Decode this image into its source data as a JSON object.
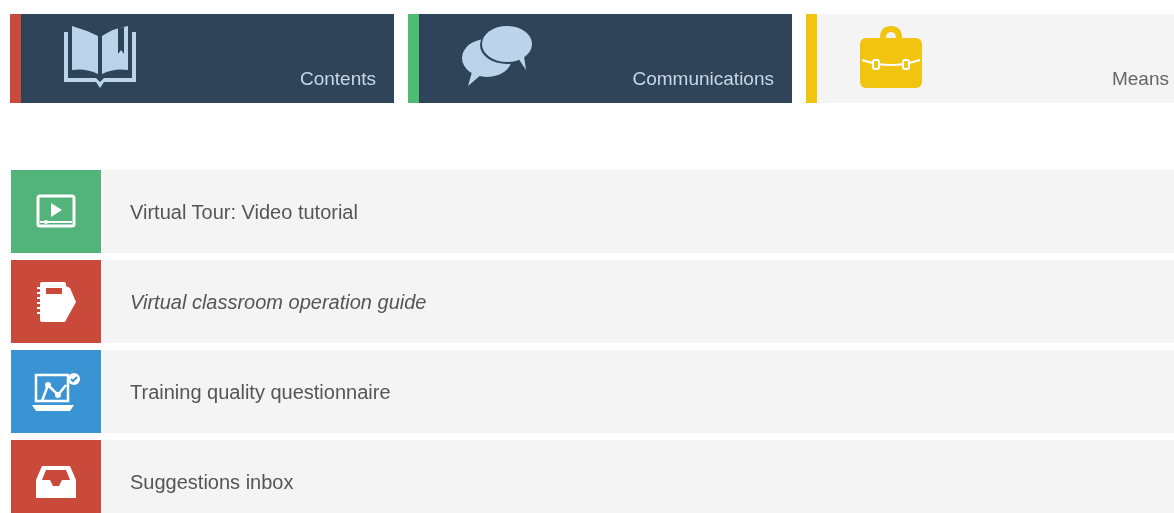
{
  "tiles": [
    {
      "label": "Contents",
      "kind": "book",
      "dark": true,
      "color": "#c9493a"
    },
    {
      "label": "Communications",
      "kind": "chat",
      "dark": true,
      "color": "#4dbd74"
    },
    {
      "label": "Means",
      "kind": "briefcase",
      "dark": false,
      "color": "#f1c40f"
    }
  ],
  "links": [
    {
      "label": "Virtual Tour: Video tutorial",
      "kind": "video",
      "color": "#52b47a",
      "italic": false
    },
    {
      "label": "Virtual classroom operation guide",
      "kind": "notebook",
      "color": "#c9493a",
      "italic": true
    },
    {
      "label": "Training quality questionnaire",
      "kind": "chart",
      "color": "#3a94d4",
      "italic": false
    },
    {
      "label": "Suggestions inbox",
      "kind": "inbox",
      "color": "#c9493a",
      "italic": false
    }
  ]
}
